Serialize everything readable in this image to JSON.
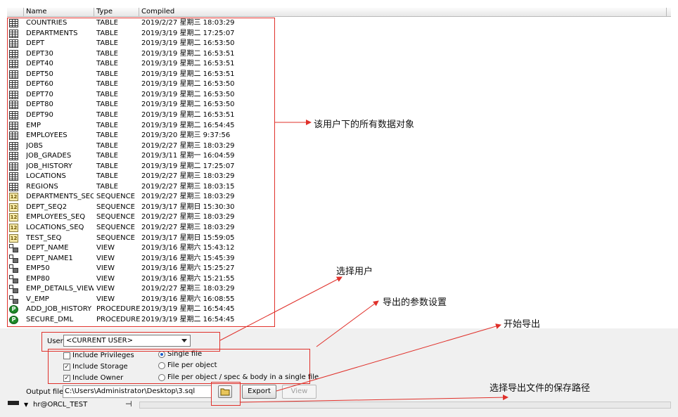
{
  "columns": {
    "name": "Name",
    "type": "Type",
    "compiled": "Compiled"
  },
  "objects": [
    {
      "icon": "table",
      "name": "COUNTRIES",
      "type": "TABLE",
      "compiled": "2019/2/27 星期三 18:03:29"
    },
    {
      "icon": "table",
      "name": "DEPARTMENTS",
      "type": "TABLE",
      "compiled": "2019/3/19 星期二 17:25:07"
    },
    {
      "icon": "table",
      "name": "DEPT",
      "type": "TABLE",
      "compiled": "2019/3/19 星期二 16:53:50"
    },
    {
      "icon": "table",
      "name": "DEPT30",
      "type": "TABLE",
      "compiled": "2019/3/19 星期二 16:53:51"
    },
    {
      "icon": "table",
      "name": "DEPT40",
      "type": "TABLE",
      "compiled": "2019/3/19 星期二 16:53:51"
    },
    {
      "icon": "table",
      "name": "DEPT50",
      "type": "TABLE",
      "compiled": "2019/3/19 星期二 16:53:51"
    },
    {
      "icon": "table",
      "name": "DEPT60",
      "type": "TABLE",
      "compiled": "2019/3/19 星期二 16:53:50"
    },
    {
      "icon": "table",
      "name": "DEPT70",
      "type": "TABLE",
      "compiled": "2019/3/19 星期二 16:53:50"
    },
    {
      "icon": "table",
      "name": "DEPT80",
      "type": "TABLE",
      "compiled": "2019/3/19 星期二 16:53:50"
    },
    {
      "icon": "table",
      "name": "DEPT90",
      "type": "TABLE",
      "compiled": "2019/3/19 星期二 16:53:51"
    },
    {
      "icon": "table",
      "name": "EMP",
      "type": "TABLE",
      "compiled": "2019/3/19 星期二 16:54:45"
    },
    {
      "icon": "table",
      "name": "EMPLOYEES",
      "type": "TABLE",
      "compiled": "2019/3/20 星期三 9:37:56"
    },
    {
      "icon": "table",
      "name": "JOBS",
      "type": "TABLE",
      "compiled": "2019/2/27 星期三 18:03:29"
    },
    {
      "icon": "table",
      "name": "JOB_GRADES",
      "type": "TABLE",
      "compiled": "2019/3/11 星期一 16:04:59"
    },
    {
      "icon": "table",
      "name": "JOB_HISTORY",
      "type": "TABLE",
      "compiled": "2019/3/19 星期二 17:25:07"
    },
    {
      "icon": "table",
      "name": "LOCATIONS",
      "type": "TABLE",
      "compiled": "2019/2/27 星期三 18:03:29"
    },
    {
      "icon": "table",
      "name": "REGIONS",
      "type": "TABLE",
      "compiled": "2019/2/27 星期三 18:03:15"
    },
    {
      "icon": "sequence",
      "name": "DEPARTMENTS_SEQ",
      "type": "SEQUENCE",
      "compiled": "2019/2/27 星期三 18:03:29"
    },
    {
      "icon": "sequence",
      "name": "DEPT_SEQ2",
      "type": "SEQUENCE",
      "compiled": "2019/3/17 星期日 15:30:30"
    },
    {
      "icon": "sequence",
      "name": "EMPLOYEES_SEQ",
      "type": "SEQUENCE",
      "compiled": "2019/2/27 星期三 18:03:29"
    },
    {
      "icon": "sequence",
      "name": "LOCATIONS_SEQ",
      "type": "SEQUENCE",
      "compiled": "2019/2/27 星期三 18:03:29"
    },
    {
      "icon": "sequence",
      "name": "TEST_SEQ",
      "type": "SEQUENCE",
      "compiled": "2019/3/17 星期日 15:59:05"
    },
    {
      "icon": "view",
      "name": "DEPT_NAME",
      "type": "VIEW",
      "compiled": "2019/3/16 星期六 15:43:12"
    },
    {
      "icon": "view",
      "name": "DEPT_NAME1",
      "type": "VIEW",
      "compiled": "2019/3/16 星期六 15:45:39"
    },
    {
      "icon": "view",
      "name": "EMP50",
      "type": "VIEW",
      "compiled": "2019/3/16 星期六 15:25:27"
    },
    {
      "icon": "view",
      "name": "EMP80",
      "type": "VIEW",
      "compiled": "2019/3/16 星期六 15:21:55"
    },
    {
      "icon": "view",
      "name": "EMP_DETAILS_VIEW",
      "type": "VIEW",
      "compiled": "2019/2/27 星期三 18:03:29"
    },
    {
      "icon": "view",
      "name": "V_EMP",
      "type": "VIEW",
      "compiled": "2019/3/16 星期六 16:08:55"
    },
    {
      "icon": "procedure",
      "name": "ADD_JOB_HISTORY",
      "type": "PROCEDURE",
      "compiled": "2019/3/19 星期二 16:54:45"
    },
    {
      "icon": "procedure",
      "name": "SECURE_DML",
      "type": "PROCEDURE",
      "compiled": "2019/3/19 星期二 16:54:45"
    }
  ],
  "user": {
    "label": "User",
    "value": "<CURRENT USER>"
  },
  "options": {
    "include_privileges": {
      "label": "Include Privileges",
      "checked": false
    },
    "include_storage": {
      "label": "Include Storage",
      "checked": true
    },
    "include_owner": {
      "label": "Include Owner",
      "checked": true
    },
    "single_file": {
      "label": "Single file",
      "selected": true
    },
    "file_per_object": {
      "label": "File per object",
      "selected": false
    },
    "file_per_object_spec": {
      "label": "File per object / spec & body in a single file",
      "selected": false
    }
  },
  "output": {
    "label": "Output file",
    "path": "C:\\Users\\Administrator\\Desktop\\3.sql"
  },
  "buttons": {
    "export": "Export",
    "view": "View"
  },
  "status": {
    "connection": "hr@ORCL_TEST"
  },
  "annotations": {
    "all_objects": "该用户下的所有数据对象",
    "select_user": "选择用户",
    "export_params": "导出的参数设置",
    "start_export": "开始导出",
    "choose_path": "选择导出文件的保存路径"
  },
  "colors": {
    "annotation": "#e0302a",
    "panel": "#f0f0f0",
    "radio_dot": "#1a5fc9",
    "procedure_icon": "#1f8a2a"
  }
}
